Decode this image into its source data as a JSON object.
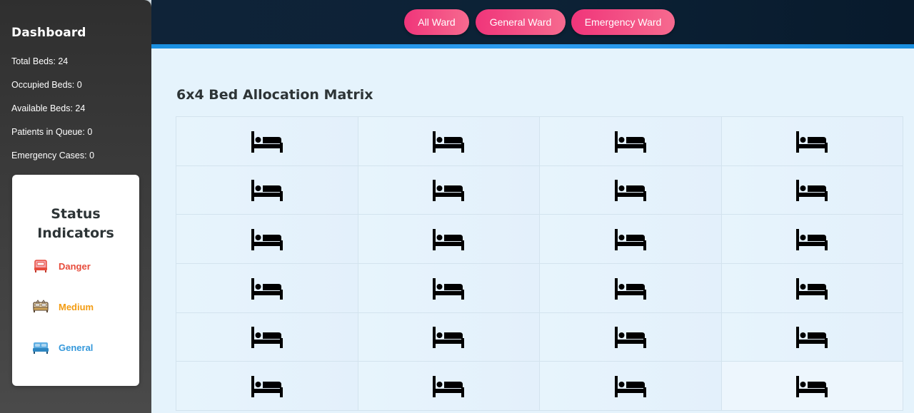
{
  "sidebar": {
    "title": "Dashboard",
    "stats": [
      "Total Beds: 24",
      "Occupied Beds: 0",
      "Available Beds: 24",
      "Patients in Queue: 0",
      "Emergency Cases: 0"
    ],
    "status_card": {
      "title": "Status Indicators",
      "items": [
        {
          "label": "Danger",
          "icon": "bed-danger-icon",
          "color": "#e74c3c"
        },
        {
          "label": "Medium",
          "icon": "bed-medium-icon",
          "color": "#f39c12"
        },
        {
          "label": "General",
          "icon": "bed-general-icon",
          "color": "#3498db"
        }
      ]
    }
  },
  "nav": {
    "buttons": [
      "All Ward",
      "General Ward",
      "Emergency Ward"
    ]
  },
  "main": {
    "title": "6x4 Bed Allocation Matrix",
    "rows": 6,
    "cols": 4,
    "bed_icon": "bed-icon"
  },
  "colors": {
    "button_gradient": [
      "#f0357a",
      "#f66a8f"
    ],
    "topbar": "#0c2236",
    "accent_line": "#2d9cf0"
  }
}
